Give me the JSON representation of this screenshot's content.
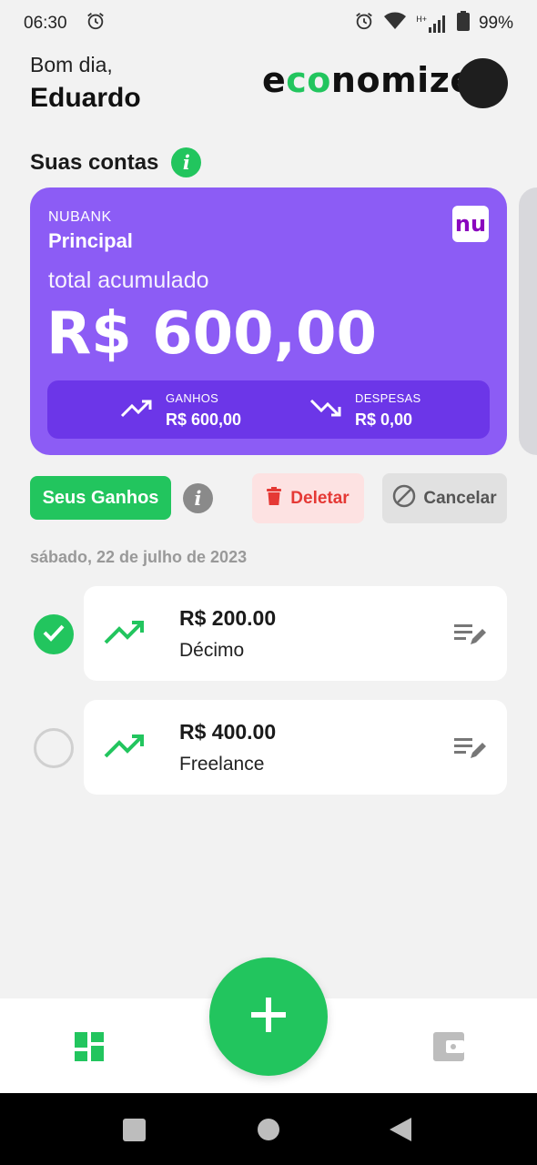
{
  "status_bar": {
    "time": "06:30",
    "battery": "99%",
    "network": "H+"
  },
  "header": {
    "greeting": "Bom dia,",
    "user_name": "Eduardo",
    "brand": {
      "before": "e",
      "mid": "co",
      "after": "nomize"
    }
  },
  "accounts_section": {
    "title": "Suas contas",
    "info_glyph": "i"
  },
  "account_card": {
    "bank": "NUBANK",
    "account_name": "Principal",
    "logo_text": "nu",
    "total_label": "total acumulado",
    "total_value": "R$ 600,00",
    "income_label": "GANHOS",
    "income_value": "R$ 600,00",
    "expense_label": "DESPESAS",
    "expense_value": "R$ 0,00",
    "color": "#8c5cf5"
  },
  "actions": {
    "earnings_label": "Seus Ganhos",
    "delete_label": "Deletar",
    "cancel_label": "Cancelar",
    "info_glyph": "i"
  },
  "transactions": {
    "date": "sábado, 22 de julho de 2023",
    "items": [
      {
        "amount": "R$ 200.00",
        "description": "Décimo",
        "selected": true
      },
      {
        "amount": "R$ 400.00",
        "description": "Freelance",
        "selected": false
      }
    ]
  },
  "colors": {
    "accent": "#22c55e",
    "danger": "#e53935"
  },
  "icons": [
    "alarm-icon",
    "wifi-icon",
    "signal-icon",
    "battery-icon",
    "moon-icon",
    "trend-up-icon",
    "trend-down-icon",
    "trash-icon",
    "cancel-icon",
    "edit-list-icon",
    "check-icon",
    "plus-icon",
    "dashboard-icon",
    "wallet-icon"
  ]
}
